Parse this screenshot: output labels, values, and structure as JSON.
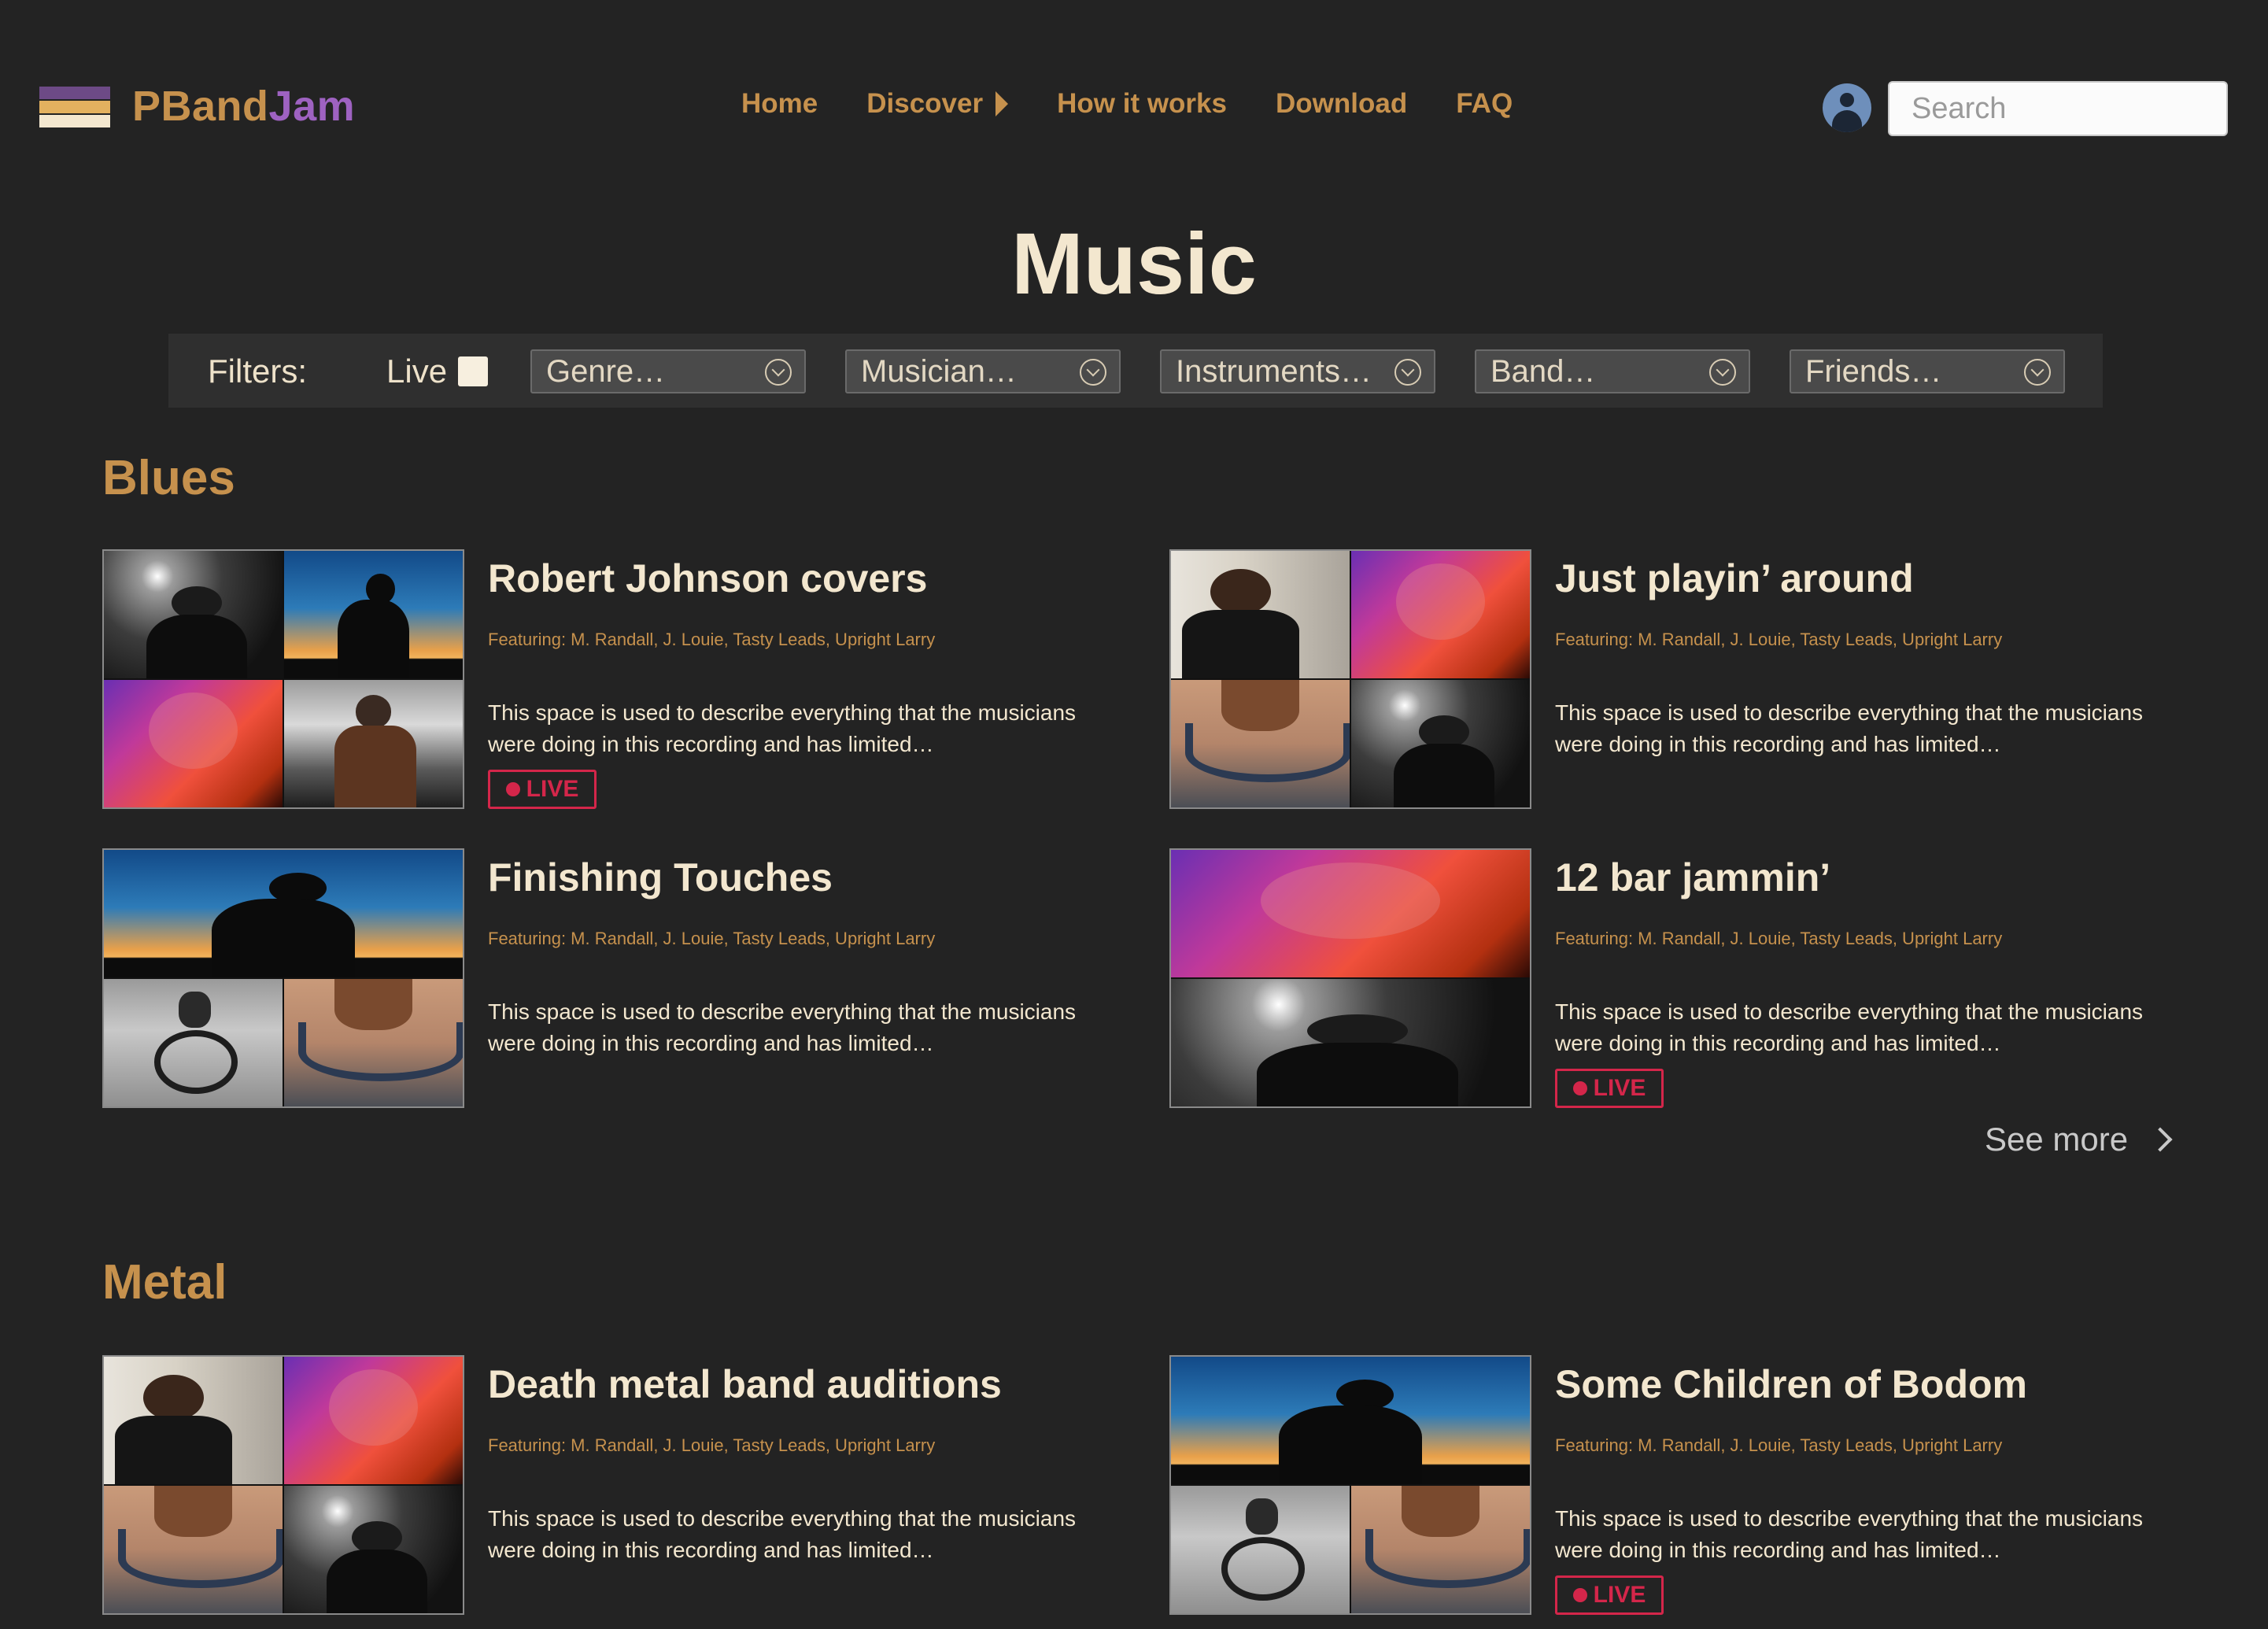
{
  "brand": {
    "name_part1": "PBand",
    "name_part2": "Jam",
    "colors": {
      "accent": "#c6914d",
      "brand_purple": "#9e62c1",
      "live_red": "#d4264a",
      "background": "#232323"
    }
  },
  "nav": {
    "items": [
      "Home",
      "Discover",
      "How it works",
      "Download",
      "FAQ"
    ]
  },
  "search": {
    "placeholder": "Search"
  },
  "page": {
    "title": "Music"
  },
  "filters": {
    "label": "Filters:",
    "live_label": "Live",
    "live_checked": false,
    "dropdowns": [
      "Genre…",
      "Musician…",
      "Instruments…",
      "Band…",
      "Friends…"
    ]
  },
  "sections": [
    {
      "title": "Blues",
      "cards": [
        {
          "title": "Robert Johnson covers",
          "featuring": "Featuring: M. Randall, J. Louie, Tasty Leads, Upright Larry",
          "description": "This space is used to describe everything that the musicians were doing in this recording and has limited…",
          "live": true,
          "images": [
            "rock-singer",
            "saxophone-silhouette",
            "guitar-closeup",
            "cellist"
          ]
        },
        {
          "title": "Just playin’ around",
          "featuring": "Featuring: M. Randall, J. Louie, Tasty Leads, Upright Larry",
          "description": "This space is used to describe everything that the musicians were doing in this recording and has limited…",
          "live": false,
          "images": [
            "young-man",
            "guitar-closeup",
            "headphones-woman",
            "rock-singer"
          ]
        },
        {
          "title": "Finishing Touches",
          "featuring": "Featuring: M. Randall, J. Louie, Tasty Leads, Upright Larry",
          "description": "This space is used to describe everything that the musicians were doing in this recording and has limited…",
          "live": false,
          "images": [
            "saxophone-silhouette",
            "microphone-headphones",
            "headphones-woman"
          ]
        },
        {
          "title": "12 bar jammin’",
          "featuring": "Featuring: M. Randall, J. Louie, Tasty Leads, Upright Larry",
          "description": "This space is used to describe everything that the musicians were doing in this recording and has limited…",
          "live": true,
          "images": [
            "guitar-closeup",
            "rock-singer"
          ]
        }
      ],
      "see_more": "See more"
    },
    {
      "title": "Metal",
      "cards": [
        {
          "title": "Death metal band auditions",
          "featuring": "Featuring: M. Randall, J. Louie, Tasty Leads, Upright Larry",
          "description": "This space is used to describe everything that the musicians were doing in this recording and has limited…",
          "live": false,
          "images": [
            "young-man",
            "guitar-closeup",
            "headphones-woman",
            "rock-singer"
          ]
        },
        {
          "title": "Some Children of Bodom",
          "featuring": "Featuring: M. Randall, J. Louie, Tasty Leads, Upright Larry",
          "description": "This space is used to describe everything that the musicians were doing in this recording and has limited…",
          "live": true,
          "images": [
            "saxophone-silhouette",
            "microphone-headphones",
            "headphones-woman"
          ]
        }
      ]
    }
  ],
  "live_badge_label": "LIVE"
}
